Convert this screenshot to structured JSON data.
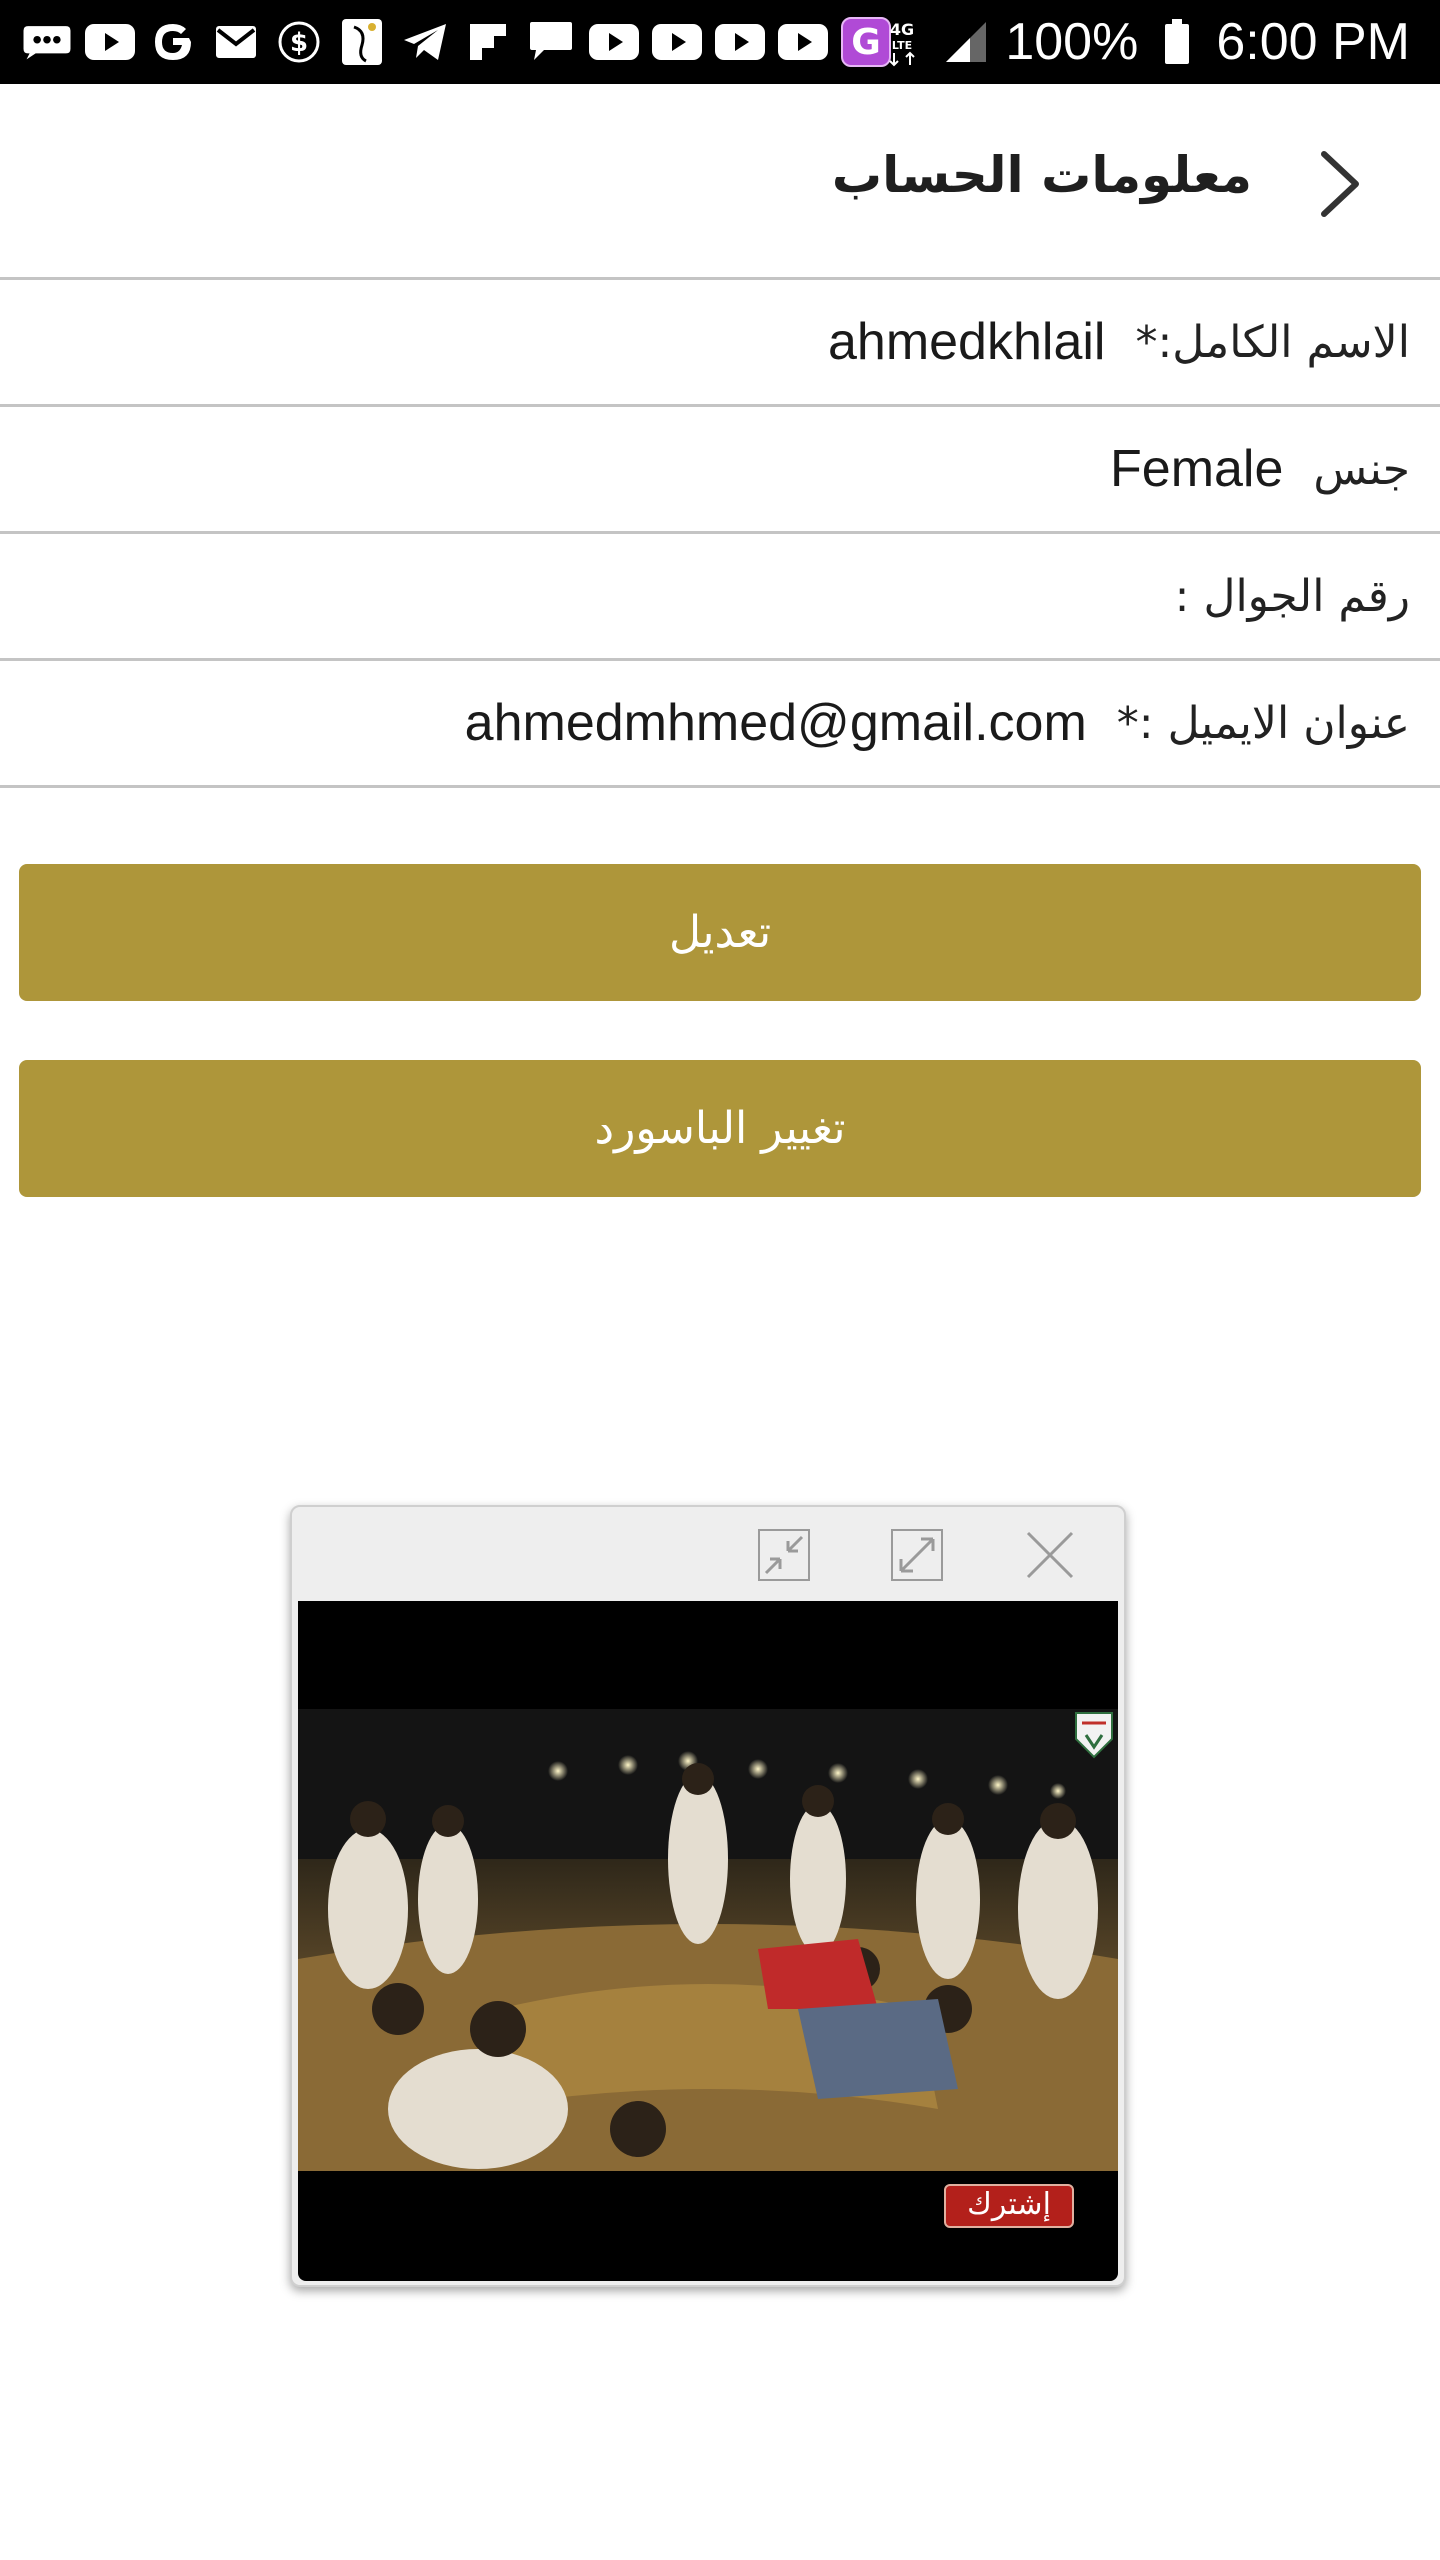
{
  "status_bar": {
    "battery": "100%",
    "time": "6:00 PM",
    "network": "4G LTE",
    "notification_icons": [
      "sms-icon",
      "youtube-icon",
      "google-icon",
      "email-icon",
      "dollar-icon",
      "bird-app-icon",
      "telegram-icon",
      "flipboard-icon",
      "chat-icon",
      "youtube-icon",
      "youtube-icon",
      "youtube-icon",
      "youtube-icon",
      "g-app-icon"
    ]
  },
  "header": {
    "title": "معلومات الحساب",
    "back_icon": "chevron-right-icon"
  },
  "form": {
    "full_name": {
      "label": "الاسم الكامل:*",
      "value": "ahmedkhlail"
    },
    "gender": {
      "label": "جنس",
      "value": "Female"
    },
    "mobile": {
      "label": "رقم الجوال :",
      "value": ""
    },
    "email": {
      "label": "عنوان الايميل :*",
      "value": "ahmedmhmed@gmail.com"
    }
  },
  "buttons": {
    "edit": "تعديل",
    "change_password": "تغيير الباسورد"
  },
  "video_player": {
    "minimize_icon": "minimize-icon",
    "maximize_icon": "maximize-icon",
    "close_icon": "close-icon",
    "subscribe_label": "إشترك"
  },
  "colors": {
    "button_gold": "#ae963a",
    "divider": "#c4c4c4",
    "status_bar": "#000000",
    "subscribe_red": "#b3201b"
  }
}
